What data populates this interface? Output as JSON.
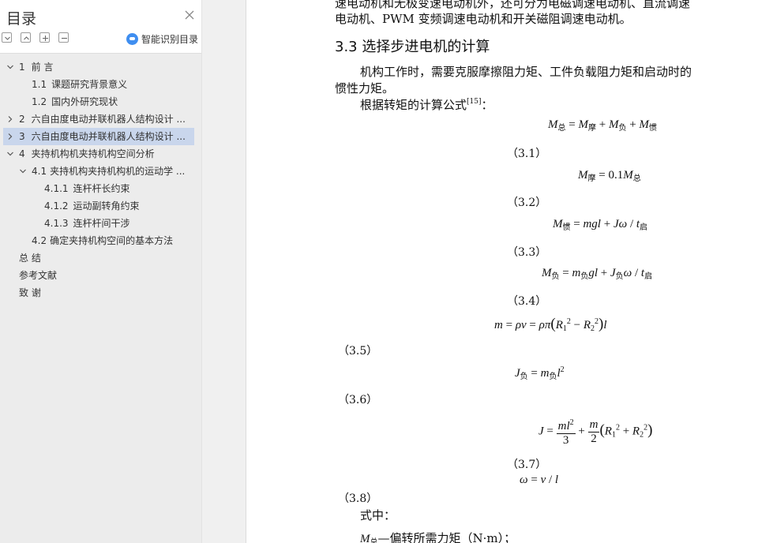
{
  "sidebar": {
    "title": "目录",
    "smart_toc_label": "智能识别目录",
    "toc": [
      {
        "num": "1",
        "text": "前  言"
      },
      {
        "num": "1.1",
        "text": "课题研究背景意义"
      },
      {
        "num": "1.2",
        "text": "国内外研究现状"
      },
      {
        "num": "2",
        "text": "六自由度电动并联机器人结构设计 ..."
      },
      {
        "num": "3",
        "text": "六自由度电动并联机器人结构设计 ..."
      },
      {
        "num": "4",
        "text": "夹持机构机夹持机构空间分析"
      },
      {
        "num": "4.1",
        "text": "夹持机构夹持机构机的运动学 ..."
      },
      {
        "num": "4.1.1",
        "text": "连杆杆长约束"
      },
      {
        "num": "4.1.2",
        "text": "运动副转角约束"
      },
      {
        "num": "4.1.3",
        "text": "连杆杆间干涉"
      },
      {
        "num": "4.2",
        "text": "确定夹持机构空间的基本方法"
      },
      {
        "num": "",
        "text": "总  结"
      },
      {
        "num": "",
        "text": "参考文献"
      },
      {
        "num": "",
        "text": "致  谢"
      }
    ],
    "selected_index": 4
  },
  "document": {
    "top_line_1": "速电动机和无极变速电动机外，还可分为电磁调速电动机、直流调速",
    "top_line_2": "电动机、PWM 变频调速电动机和开关磁阻调速电动机。",
    "heading": "3.3 选择步进电机的计算",
    "para1_line1": "机构工作时，需要克服摩擦阻力矩、工件负载阻力矩和启动时的",
    "para1_line2": "惯性力矩。",
    "para2": "根据转矩的计算公式",
    "para2_ref": "[15]",
    "para2_tail": "：",
    "eq_numbers": [
      "（3.1）",
      "（3.2）",
      "（3.3）",
      "（3.4）",
      "（3.5）",
      "（3.6）",
      "（3.7）",
      "（3.8）"
    ],
    "where_label": "式中：",
    "def_line_tail": "—偏转所需力矩（N·m）；",
    "eq_sub_labels": {
      "total": "总",
      "friction": "摩",
      "load": "负",
      "inertia": "惯"
    }
  },
  "colors": {
    "selected_bg": "#c9d6ec",
    "toc_bg": "#ececec",
    "accent": "#3f8ef0"
  }
}
